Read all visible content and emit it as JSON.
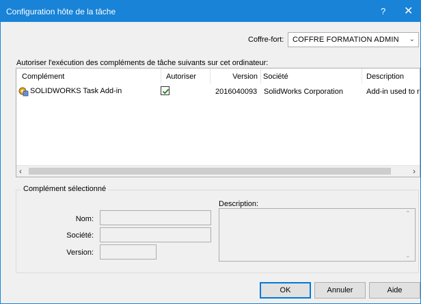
{
  "window": {
    "title": "Configuration hôte de la tâche",
    "help_glyph": "?",
    "close_glyph": "✕"
  },
  "vault": {
    "label": "Coffre-fort:",
    "value": "COFFRE FORMATION ADMIN"
  },
  "allow_text": "Autoriser l'exécution des compléments de tâche suivants sur cet ordinateur:",
  "table": {
    "columns": [
      "Complément",
      "Autoriser",
      "Version",
      "Société",
      "Description"
    ],
    "rows": [
      {
        "name": "SOLIDWORKS Task Add-in",
        "allowed": true,
        "version": "2016040093",
        "company": "SolidWorks Corporation",
        "description": "Add-in used to ru"
      }
    ]
  },
  "selected": {
    "legend": "Complément sélectionné",
    "name_label": "Nom:",
    "company_label": "Société:",
    "version_label": "Version:",
    "name_value": "",
    "company_value": "",
    "version_value": "",
    "description_label": "Description:",
    "description_value": ""
  },
  "buttons": {
    "ok": "OK",
    "cancel": "Annuler",
    "help": "Aide"
  },
  "colors": {
    "titlebar": "#1883d7",
    "dialog_bg": "#f0f0f0"
  }
}
